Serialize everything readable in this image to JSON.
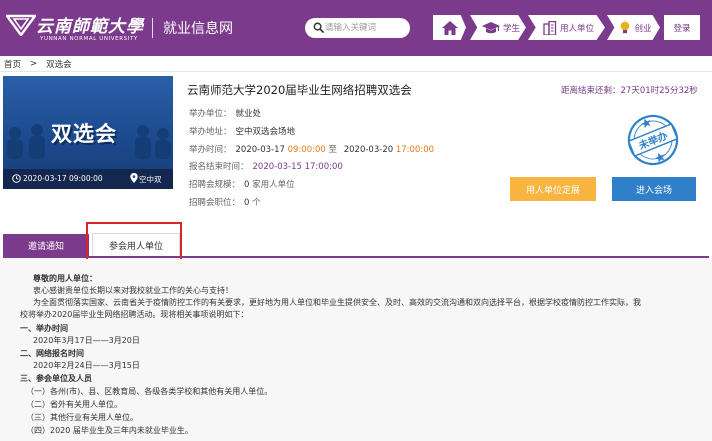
{
  "header": {
    "logo_cn": "云南師範大學",
    "logo_en": "YUNNAN NORMAL UNIVERSITY",
    "site_name": "就业信息网",
    "search_placeholder": "请输入关键词",
    "nav": {
      "student": "学生",
      "employer": "用人单位",
      "startup": "创业",
      "login": "登录"
    },
    "colors": {
      "brand": "#7b3a8c"
    }
  },
  "breadcrumb": {
    "home": "首页",
    "sep": ">",
    "current": "双选会"
  },
  "banner": {
    "title": "双选会",
    "date": "2020-03-17 09:00:00",
    "place": "空中双"
  },
  "event": {
    "title": "云南师范大学2020届毕业生网络招聘双选会",
    "countdown": "距离结束还剩：27天01时25分32秒",
    "organizer_label": "举办单位：",
    "organizer": "就业处",
    "address_label": "举办地址：",
    "address": "空中双选会场地",
    "time_label": "举办时间：",
    "start_date": "2020-03-17",
    "start_time": "09:00:00",
    "to": "至",
    "end_date": "2020-03-20",
    "end_time": "17:00:00",
    "signup_end_label": "报名结束时间：",
    "signup_end": "2020-03-15 17:00:00",
    "scale_label": "招聘会规模：",
    "scale_value": "0",
    "scale_unit": "家用人单位",
    "positions_label": "招聘会职位：",
    "positions_value": "0",
    "positions_unit": "个",
    "stamp_text": "未举办",
    "btn_employer": "用人单位定展",
    "btn_enter": "进入会场"
  },
  "tabs": {
    "invite": "邀请通知",
    "units": "参会用人单位"
  },
  "notice": {
    "salutation": "尊敬的用人单位：",
    "thanks": "衷心感谢贵单位长期以来对我校就业工作的关心与支持！",
    "para1": "为全面贯彻落实国家、云南省关于疫情防控工作的有关要求，更好地为用人单位和毕业生提供安全、及时、高效的交流沟通和双向选择平台，根据学校疫情防控工作实际，我",
    "para2": "校将举办2020届毕业生网络招聘活动。现将相关事项说明如下：",
    "h1": "一、举办时间",
    "h1_text": "2020年3月17日——3月20日",
    "h2": "二、网络报名时间",
    "h2_text": "2020年2月24日——3月15日",
    "h3": "三、参会单位及人员",
    "item1": "（一）各州(市)、县、区教育局、各级各类学校和其他有关用人单位。",
    "item2": "（二）省外有关用人单位。",
    "item3": "（三）其他行业有关用人单位。",
    "item4": "（四）2020 届毕业生及三年内未就业毕业生。"
  }
}
